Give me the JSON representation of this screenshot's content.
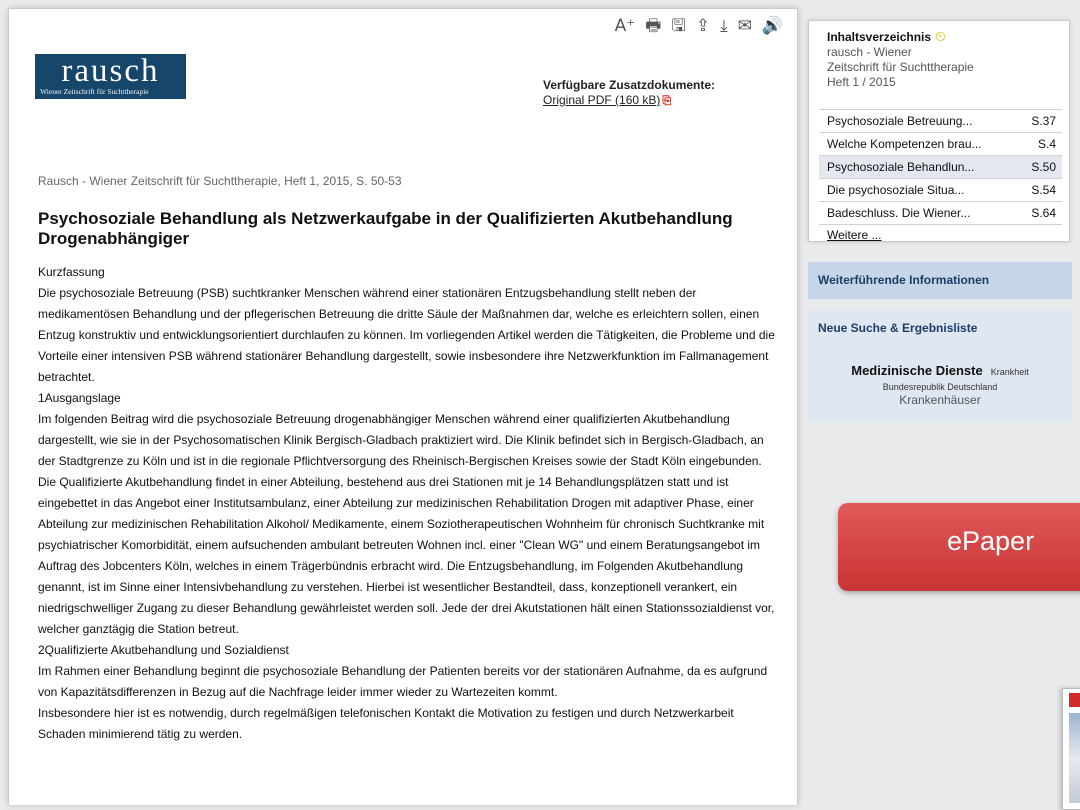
{
  "toolbar": {
    "icons": [
      {
        "name": "font-size-icon",
        "glyph": "A⁺"
      },
      {
        "name": "print-icon",
        "glyph": "🖶"
      },
      {
        "name": "save-icon",
        "glyph": "🖫"
      },
      {
        "name": "upload-icon",
        "glyph": "⇪"
      },
      {
        "name": "download-icon",
        "glyph": "⤓"
      },
      {
        "name": "mail-icon",
        "glyph": "✉"
      },
      {
        "name": "speaker-icon",
        "glyph": "🔊"
      }
    ]
  },
  "logo": {
    "title": "rausch",
    "subtitle": "Wiener Zeitschrift für Suchttherapie",
    "color": "#16476b"
  },
  "additional_docs": {
    "heading": "Verfügbare Zusatzdokumente:",
    "link": "Original PDF ",
    "size": "(160 kB)"
  },
  "article": {
    "citation": "Rausch - Wiener Zeitschrift für Suchttherapie, Heft 1, 2015, S. 50-53",
    "title": "Psychosoziale Behandlung als Netzwerkaufgabe in der Qualifizierten Akutbehandlung Drogenabhängiger",
    "paragraphs": [
      "Kurzfassung",
      "Die psychosoziale Betreuung (PSB) suchtkranker Menschen während einer stationären Entzugsbehandlung stellt neben der medikamentösen Behandlung und der pflegerischen Betreuung die dritte Säule der Maßnahmen dar, welche es erleichtern sollen, einen Entzug konstruktiv und entwicklungsorientiert durchlaufen zu können. Im vorliegenden Artikel werden die Tätigkeiten, die Probleme und die Vorteile einer intensiven PSB während stationärer Behandlung dargestellt, sowie insbesondere ihre Netzwerkfunktion im Fallmanagement betrachtet.",
      "1Ausgangslage",
      "Im folgenden Beitrag wird die psychosoziale Betreuung drogenabhängiger Menschen während einer qualifizierten Akutbehandlung dargestellt, wie sie in der Psychosomatischen Klinik Bergisch-Gladbach praktiziert wird. Die Klinik befindet sich in Bergisch-Gladbach, an der Stadtgrenze zu Köln und ist in die regionale Pflichtversorgung des Rheinisch-Bergischen Kreises sowie der Stadt Köln eingebunden. Die Qualifizierte Akutbehandlung findet in einer Abteilung, bestehend aus drei Stationen mit je 14 Behandlungsplätzen statt und ist eingebettet in das Angebot einer Institutsambulanz, einer Abteilung zur medizinischen Rehabilitation Drogen mit adaptiver Phase, einer Abteilung zur medizinischen Rehabilitation Alkohol/ Medikamente, einem Soziotherapeutischen Wohnheim für chronisch Suchtkranke mit psychiatrischer Komorbidität, einem aufsuchenden ambulant betreuten Wohnen incl. einer \"Clean WG\" und einem Beratungsangebot im Auftrag des Jobcenters Köln, welches in einem Trägerbündnis erbracht wird. Die Entzugsbehandlung, im Folgenden Akutbehandlung genannt, ist im Sinne einer Intensivbehandlung zu verstehen. Hierbei ist wesentlicher Bestandteil, dass, konzeptionell verankert, ein niedrigschwelliger Zugang zu dieser Behandlung gewährleistet werden soll. Jede der drei Akutstationen hält einen Stationssozialdienst vor, welcher ganztägig die Station betreut.",
      "2Qualifizierte Akutbehandlung und Sozialdienst",
      "Im Rahmen einer Behandlung beginnt die psychosoziale Behandlung der Patienten bereits vor der stationären Aufnahme, da es aufgrund von Kapazitätsdifferenzen in Bezug auf die Nachfrage leider immer wieder zu Wartezeiten kommt.",
      "Insbesondere hier ist es notwendig, durch regelmäßigen telefonischen Kontakt die Motivation zu festigen und durch Netzwerkarbeit Schaden minimierend tätig zu werden."
    ]
  },
  "toc": {
    "heading": "Inhaltsverzeichnis",
    "source_line1": "rausch - Wiener",
    "source_line2": "Zeitschrift für Suchttherapie",
    "issue": "Heft 1 / 2015",
    "items": [
      {
        "title": "Psychosoziale Betreuung...",
        "page": "S.37"
      },
      {
        "title": "Welche Kompetenzen brau...",
        "page": "S.4"
      },
      {
        "title": "Psychosoziale Behandlun...",
        "page": "S.50"
      },
      {
        "title": "Die psychosoziale Situa...",
        "page": "S.54"
      },
      {
        "title": "Badeschluss. Die Wiener...",
        "page": "S.64"
      }
    ],
    "more": "Weitere ..."
  },
  "sidebar": {
    "further_info": "Weiterführende Informationen",
    "new_search": "Neue Suche & Ergebnisliste",
    "tags": [
      "Medizinische Dienste",
      "Krankheit",
      "Bundesrepublik Deutschland",
      "Krankenhäuser"
    ]
  },
  "epaper": {
    "label": "ePaper",
    "color": "#d03a3a"
  }
}
